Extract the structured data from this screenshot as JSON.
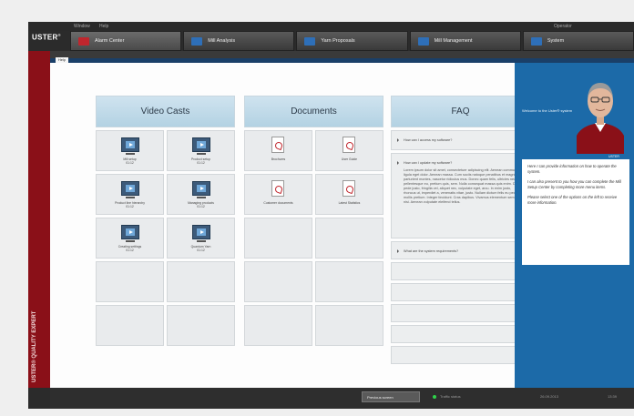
{
  "app": {
    "brand": "USTER",
    "menu": [
      "Window",
      "Help"
    ],
    "user": "Operator",
    "sidebar_vertical": "USTER® QUALITY EXPERT"
  },
  "tabs": [
    {
      "label": "Alarm Center",
      "color": "#c0262d",
      "active": true
    },
    {
      "label": "Mill Analysis",
      "color": "#2e6fb8",
      "active": false
    },
    {
      "label": "Yarn Proposals",
      "color": "#2e6fb8",
      "active": false
    },
    {
      "label": "Mill Management",
      "color": "#2e6fb8",
      "active": false
    },
    {
      "label": "System",
      "color": "#2e6fb8",
      "active": false
    }
  ],
  "subtab": "Help",
  "video_casts": {
    "title": "Video Casts",
    "items": [
      {
        "label": "Mill setup\n01:12"
      },
      {
        "label": "Product setup\n01:12"
      },
      {
        "label": "Product line hierarchy\n01:12"
      },
      {
        "label": "Managing products\n01:12"
      },
      {
        "label": "Creating settings\n01:12"
      },
      {
        "label": "Quantum Yarn\n01:12"
      }
    ]
  },
  "documents": {
    "title": "Documents",
    "items": [
      {
        "label": "Brochures"
      },
      {
        "label": "User Guide"
      },
      {
        "label": "Customer documents"
      },
      {
        "label": "Latest Statistics"
      }
    ]
  },
  "faq": {
    "title": "FAQ",
    "items": [
      {
        "q": "How can I access my software?",
        "expanded": false
      },
      {
        "q": "How can I update my software?",
        "expanded": true,
        "a": "Lorem ipsum dolor sit amet, consectetuer adipiscing elit. Aenean commodo ligula eget dolor. Aenean massa. Cum sociis natoque penatibus et magnis dis parturient montes, nascetur ridiculus mus. Donec quam felis, ultricies nec, pellentesque eu, pretium quis, sem. Nulla consequat massa quis enim. Donec pede justo, fringilla vel, aliquet nec, vulputate eget, arcu. In enim justo, rhoncus ut, imperdiet a, venenatis vitae, justo. Nullam dictum felis eu pede mollis pretium. Integer tincidunt. Cras dapibus. Vivamus elementum semper nisi. Aenean vulputate eleifend tellus."
      },
      {
        "q": "What are the system requirements?",
        "expanded": false
      }
    ]
  },
  "right_panel": {
    "welcome": "Welcome to the Uster® system",
    "badge": "USTER",
    "help_paragraphs": [
      "Here I can provide information on how to operate the system.",
      "I can also present to you how you can complete the Mill Setup Center by completing more menu items.",
      "Please select one of the options on the left to receive more information."
    ]
  },
  "status": {
    "button": "Previous screen",
    "traffic_label": "Traffic status",
    "date": "26.09.2013",
    "time": "13:39"
  },
  "colors": {
    "accent_red": "#8a1018",
    "panel_blue": "#1c6aa8",
    "header_blue": "#cfe3ef"
  }
}
